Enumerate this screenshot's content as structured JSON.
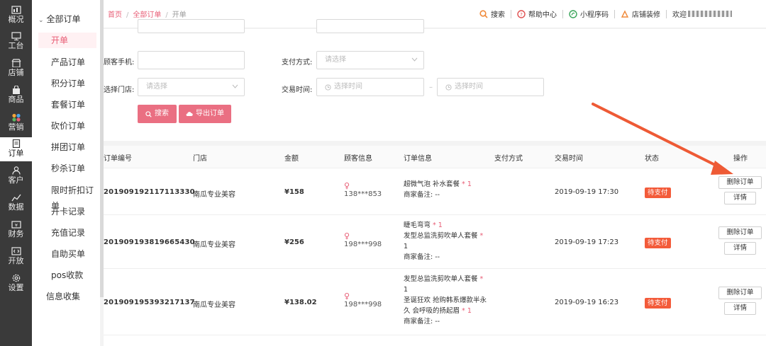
{
  "rail": [
    {
      "label": "概况",
      "icon": "dashboard-icon"
    },
    {
      "label": "工台",
      "icon": "monitor-icon"
    },
    {
      "label": "店铺",
      "icon": "store-icon"
    },
    {
      "label": "商品",
      "icon": "bag-icon"
    },
    {
      "label": "营销",
      "icon": "marketing-icon"
    },
    {
      "label": "订单",
      "icon": "order-icon",
      "active": true
    },
    {
      "label": "客户",
      "icon": "user-icon"
    },
    {
      "label": "数据",
      "icon": "chart-icon"
    },
    {
      "label": "财务",
      "icon": "finance-icon"
    },
    {
      "label": "开放",
      "icon": "code-icon"
    },
    {
      "label": "设置",
      "icon": "gear-icon"
    }
  ],
  "submenu": {
    "header": "全部订单",
    "items": [
      "开单",
      "产品订单",
      "积分订单",
      "套餐订单",
      "砍价订单",
      "拼团订单",
      "秒杀订单",
      "限时折扣订单",
      "开卡记录",
      "充值记录",
      "自助买单",
      "pos收款",
      "信息收集"
    ]
  },
  "breadcrumb": {
    "home": "首页",
    "all": "全部订单",
    "current": "开单",
    "sep": "/"
  },
  "tools": {
    "search": "搜索",
    "help": "帮助中心",
    "miniapp": "小程序码",
    "decor": "店铺装修",
    "welcome": "欢迎"
  },
  "filter": {
    "phone_label": "顾客手机:",
    "pay_label": "支付方式:",
    "pay_placeholder": "请选择",
    "store_label": "选择门店:",
    "store_placeholder": "请选择",
    "time_label": "交易时间:",
    "time_start_placeholder": "选择时间",
    "time_end_placeholder": "选择时间",
    "dash": "–",
    "search_btn": "搜索",
    "export_btn": "导出订单"
  },
  "table": {
    "headers": [
      "订单编号",
      "门店",
      "金额",
      "顾客信息",
      "订单信息",
      "支付方式",
      "交易时间",
      "状态",
      "操作"
    ],
    "rows": [
      {
        "no": "201909192117113330",
        "store": "南瓜专业美容",
        "amount": "¥158",
        "customer": "138***853",
        "info": [
          {
            "t": "超微气泡 补水套餐 ",
            "q": "* 1"
          },
          {
            "t": "商家备注: --",
            "q": ""
          }
        ],
        "time": "2019-09-19 17:30",
        "status": "待支付",
        "op_delete": "删除订单",
        "op_detail": "详情"
      },
      {
        "no": "201909193819665430",
        "store": "南瓜专业美容",
        "amount": "¥256",
        "customer": "198***998",
        "info": [
          {
            "t": "睫毛弯弯 ",
            "q": "* 1"
          },
          {
            "t": "发型总监洗剪吹单人套餐 ",
            "q": "*"
          },
          {
            "t": "1",
            "q": ""
          },
          {
            "t": "商家备注: --",
            "q": ""
          }
        ],
        "time": "2019-09-19 17:23",
        "status": "待支付",
        "op_delete": "删除订单",
        "op_detail": "详情"
      },
      {
        "no": "201909195393217137",
        "store": "南瓜专业美容",
        "amount": "¥138.02",
        "customer": "198***998",
        "info": [
          {
            "t": "发型总监洗剪吹单人套餐 ",
            "q": "*"
          },
          {
            "t": "1",
            "q": ""
          },
          {
            "t": "圣诞狂欢 抢购韩系爆款半永",
            "q": ""
          },
          {
            "t": "久 会呼吸的扬起眉 ",
            "q": "* 1"
          },
          {
            "t": "商家备注: --",
            "q": ""
          }
        ],
        "time": "2019-09-19 16:23",
        "status": "待支付",
        "op_delete": "删除订单",
        "op_detail": "详情"
      }
    ]
  },
  "colors": {
    "accent": "#e85d75",
    "status": "#f35b3a",
    "rail": "#3a3a3a",
    "arrow": "#ee5a35"
  }
}
